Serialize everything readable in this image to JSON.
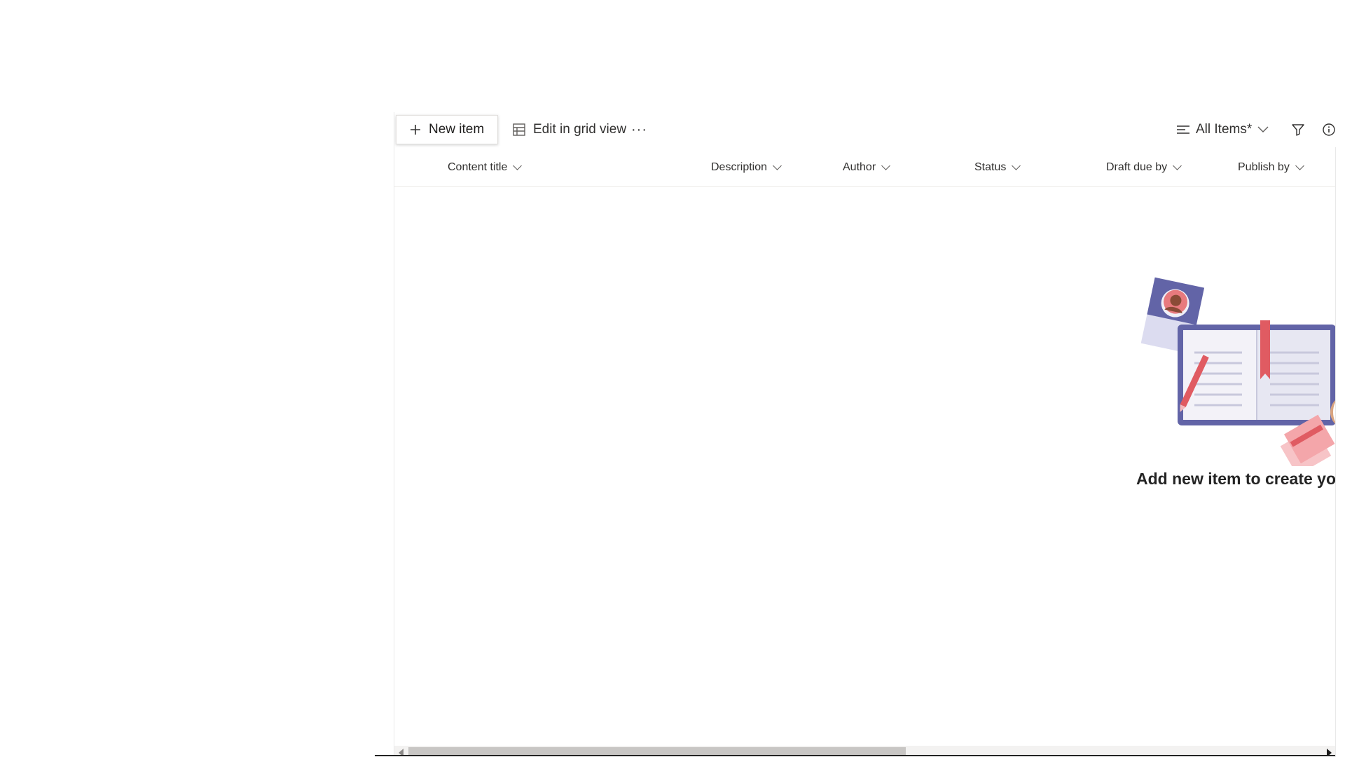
{
  "toolbar": {
    "new_item_label": "New item",
    "grid_view_label": "Edit in grid view",
    "more_label": "···",
    "view_label": "All Items*"
  },
  "columns": [
    {
      "label": "Content title"
    },
    {
      "label": "Description"
    },
    {
      "label": "Author"
    },
    {
      "label": "Status"
    },
    {
      "label": "Draft due by"
    },
    {
      "label": "Publish by"
    }
  ],
  "empty_state": {
    "message": "Add new item to create yo"
  },
  "colors": {
    "accent_purple": "#6264a7",
    "accent_red": "#e05b62",
    "text": "#323130"
  },
  "icons": [
    "add-icon",
    "grid-view-icon",
    "more-icon",
    "view-list-icon",
    "chevron-down-icon",
    "filter-icon",
    "info-icon"
  ]
}
